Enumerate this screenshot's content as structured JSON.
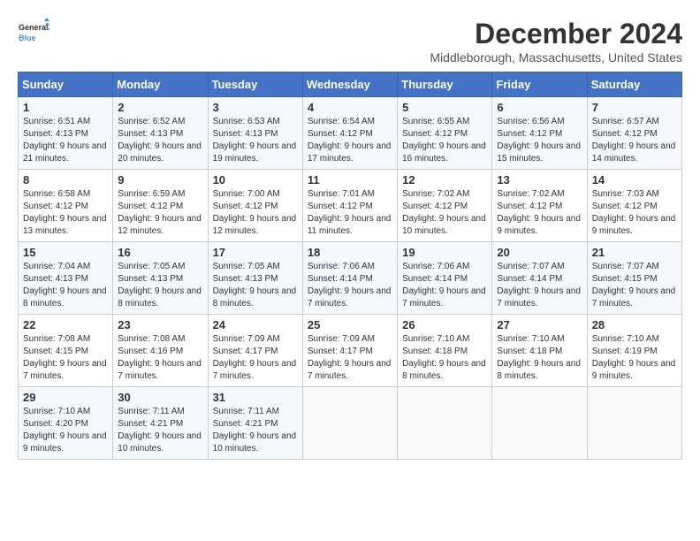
{
  "logo": {
    "text_general": "General",
    "text_blue": "Blue"
  },
  "calendar": {
    "title": "December 2024",
    "subtitle": "Middleborough, Massachusetts, United States"
  },
  "days_of_week": [
    "Sunday",
    "Monday",
    "Tuesday",
    "Wednesday",
    "Thursday",
    "Friday",
    "Saturday"
  ],
  "weeks": [
    [
      {
        "day": 1,
        "sunrise": "6:51 AM",
        "sunset": "4:13 PM",
        "daylight": "9 hours and 21 minutes."
      },
      {
        "day": 2,
        "sunrise": "6:52 AM",
        "sunset": "4:13 PM",
        "daylight": "9 hours and 20 minutes."
      },
      {
        "day": 3,
        "sunrise": "6:53 AM",
        "sunset": "4:13 PM",
        "daylight": "9 hours and 19 minutes."
      },
      {
        "day": 4,
        "sunrise": "6:54 AM",
        "sunset": "4:12 PM",
        "daylight": "9 hours and 17 minutes."
      },
      {
        "day": 5,
        "sunrise": "6:55 AM",
        "sunset": "4:12 PM",
        "daylight": "9 hours and 16 minutes."
      },
      {
        "day": 6,
        "sunrise": "6:56 AM",
        "sunset": "4:12 PM",
        "daylight": "9 hours and 15 minutes."
      },
      {
        "day": 7,
        "sunrise": "6:57 AM",
        "sunset": "4:12 PM",
        "daylight": "9 hours and 14 minutes."
      }
    ],
    [
      {
        "day": 8,
        "sunrise": "6:58 AM",
        "sunset": "4:12 PM",
        "daylight": "9 hours and 13 minutes."
      },
      {
        "day": 9,
        "sunrise": "6:59 AM",
        "sunset": "4:12 PM",
        "daylight": "9 hours and 12 minutes."
      },
      {
        "day": 10,
        "sunrise": "7:00 AM",
        "sunset": "4:12 PM",
        "daylight": "9 hours and 12 minutes."
      },
      {
        "day": 11,
        "sunrise": "7:01 AM",
        "sunset": "4:12 PM",
        "daylight": "9 hours and 11 minutes."
      },
      {
        "day": 12,
        "sunrise": "7:02 AM",
        "sunset": "4:12 PM",
        "daylight": "9 hours and 10 minutes."
      },
      {
        "day": 13,
        "sunrise": "7:02 AM",
        "sunset": "4:12 PM",
        "daylight": "9 hours and 9 minutes."
      },
      {
        "day": 14,
        "sunrise": "7:03 AM",
        "sunset": "4:12 PM",
        "daylight": "9 hours and 9 minutes."
      }
    ],
    [
      {
        "day": 15,
        "sunrise": "7:04 AM",
        "sunset": "4:13 PM",
        "daylight": "9 hours and 8 minutes."
      },
      {
        "day": 16,
        "sunrise": "7:05 AM",
        "sunset": "4:13 PM",
        "daylight": "9 hours and 8 minutes."
      },
      {
        "day": 17,
        "sunrise": "7:05 AM",
        "sunset": "4:13 PM",
        "daylight": "9 hours and 8 minutes."
      },
      {
        "day": 18,
        "sunrise": "7:06 AM",
        "sunset": "4:14 PM",
        "daylight": "9 hours and 7 minutes."
      },
      {
        "day": 19,
        "sunrise": "7:06 AM",
        "sunset": "4:14 PM",
        "daylight": "9 hours and 7 minutes."
      },
      {
        "day": 20,
        "sunrise": "7:07 AM",
        "sunset": "4:14 PM",
        "daylight": "9 hours and 7 minutes."
      },
      {
        "day": 21,
        "sunrise": "7:07 AM",
        "sunset": "4:15 PM",
        "daylight": "9 hours and 7 minutes."
      }
    ],
    [
      {
        "day": 22,
        "sunrise": "7:08 AM",
        "sunset": "4:15 PM",
        "daylight": "9 hours and 7 minutes."
      },
      {
        "day": 23,
        "sunrise": "7:08 AM",
        "sunset": "4:16 PM",
        "daylight": "9 hours and 7 minutes."
      },
      {
        "day": 24,
        "sunrise": "7:09 AM",
        "sunset": "4:17 PM",
        "daylight": "9 hours and 7 minutes."
      },
      {
        "day": 25,
        "sunrise": "7:09 AM",
        "sunset": "4:17 PM",
        "daylight": "9 hours and 7 minutes."
      },
      {
        "day": 26,
        "sunrise": "7:10 AM",
        "sunset": "4:18 PM",
        "daylight": "9 hours and 8 minutes."
      },
      {
        "day": 27,
        "sunrise": "7:10 AM",
        "sunset": "4:18 PM",
        "daylight": "9 hours and 8 minutes."
      },
      {
        "day": 28,
        "sunrise": "7:10 AM",
        "sunset": "4:19 PM",
        "daylight": "9 hours and 9 minutes."
      }
    ],
    [
      {
        "day": 29,
        "sunrise": "7:10 AM",
        "sunset": "4:20 PM",
        "daylight": "9 hours and 9 minutes."
      },
      {
        "day": 30,
        "sunrise": "7:11 AM",
        "sunset": "4:21 PM",
        "daylight": "9 hours and 10 minutes."
      },
      {
        "day": 31,
        "sunrise": "7:11 AM",
        "sunset": "4:21 PM",
        "daylight": "9 hours and 10 minutes."
      },
      null,
      null,
      null,
      null
    ]
  ]
}
